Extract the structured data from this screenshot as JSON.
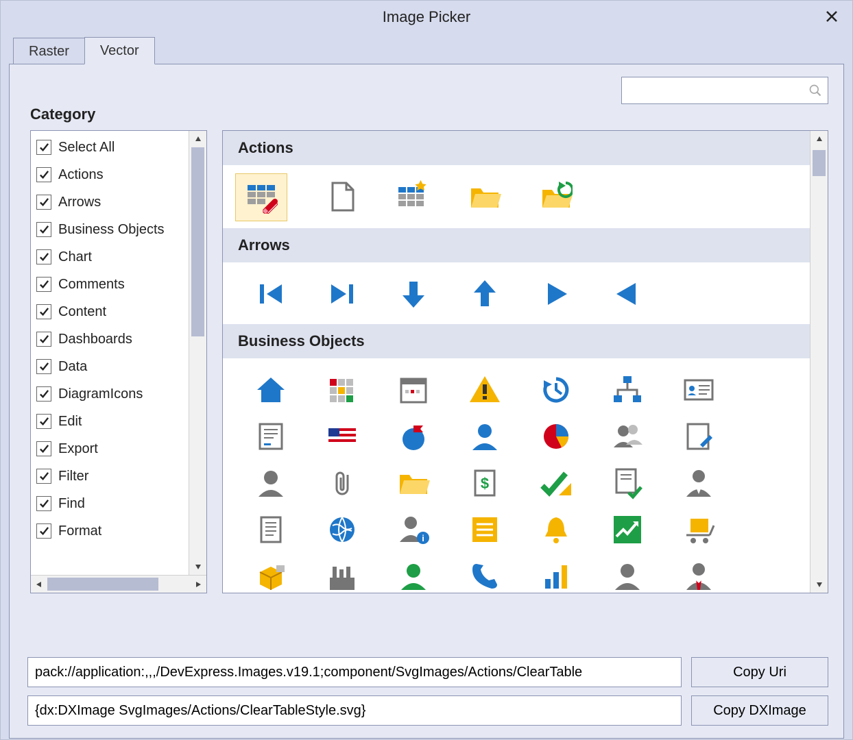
{
  "window": {
    "title": "Image Picker"
  },
  "tabs": {
    "raster": "Raster",
    "vector": "Vector",
    "active": "Vector"
  },
  "search": {
    "placeholder": ""
  },
  "category": {
    "label": "Category",
    "items": [
      {
        "label": "Select All",
        "checked": true
      },
      {
        "label": "Actions",
        "checked": true
      },
      {
        "label": "Arrows",
        "checked": true
      },
      {
        "label": "Business Objects",
        "checked": true
      },
      {
        "label": "Chart",
        "checked": true
      },
      {
        "label": "Comments",
        "checked": true
      },
      {
        "label": "Content",
        "checked": true
      },
      {
        "label": "Dashboards",
        "checked": true
      },
      {
        "label": "Data",
        "checked": true
      },
      {
        "label": "DiagramIcons",
        "checked": true
      },
      {
        "label": "Edit",
        "checked": true
      },
      {
        "label": "Export",
        "checked": true
      },
      {
        "label": "Filter",
        "checked": true
      },
      {
        "label": "Find",
        "checked": true
      },
      {
        "label": "Format",
        "checked": true
      }
    ]
  },
  "groups": {
    "actions": "Actions",
    "arrows": "Arrows",
    "business_objects": "Business Objects"
  },
  "footer": {
    "uri_value": "pack://application:,,,/DevExpress.Images.v19.1;component/SvgImages/Actions/ClearTable",
    "copy_uri": "Copy Uri",
    "dximage_value": "{dx:DXImage SvgImages/Actions/ClearTableStyle.svg}",
    "copy_dximage": "Copy DXImage"
  },
  "colors": {
    "blue": "#1f77c9",
    "yellow": "#f5b400",
    "green": "#1e9e46",
    "red": "#d0021b",
    "gray": "#757575"
  }
}
